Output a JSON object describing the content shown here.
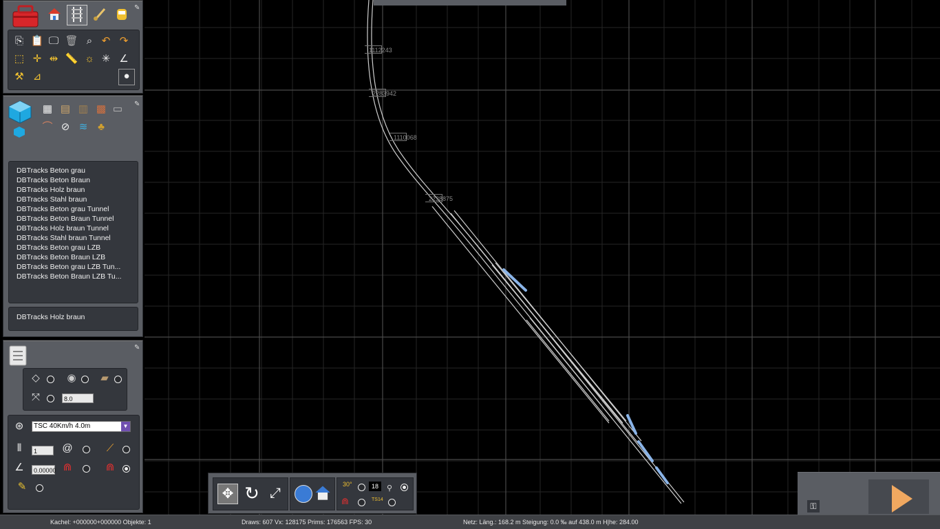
{
  "track_tags": [
    {
      "label": "1112243"
    },
    {
      "label": "2283942"
    },
    {
      "label": "1110068"
    },
    {
      "label": "2238875"
    }
  ],
  "track_list": {
    "items": [
      "DBTracks Beton grau",
      "DBTracks Beton Braun",
      "DBTracks Holz braun",
      "DBTracks Stahl braun",
      "DBTracks Beton grau Tunnel",
      "DBTracks Beton Braun Tunnel",
      "DBTracks Holz braun Tunnel",
      "DBTracks Stahl braun Tunnel",
      "DBTracks Beton grau LZB",
      "DBTracks Beton Braun LZB",
      "DBTracks Beton grau LZB Tun...",
      "DBTracks Beton Braun LZB Tu..."
    ],
    "selected": "DBTracks Holz braun"
  },
  "track_settings": {
    "spacing_value": "8.0",
    "track_rule": "TSC 40Km/h 4.0m",
    "count_value": "1",
    "gradient_value": "0.00000"
  },
  "bottom_toolbar": {
    "number_box": "18",
    "ts14_label": "TS14",
    "angle_label": "30°"
  },
  "status": {
    "tile": "Kachel: +000000+000000  Objekte: 1",
    "render": "Draws: 607 Vx: 128175 Prims: 176563 FPS: 30",
    "net": "Netz:  Läng.:  168.2 m Steigung:  0.0 ‰ auf 438.0 m H|he: 284.00"
  },
  "colors": {
    "panel_bg": "#5a5d63",
    "panel_inner": "#34373d",
    "grid_line": "#2f2f2f",
    "grid_major": "#4a4a4a",
    "track": "#cfcfcf",
    "selected_track": "#8ab4e8",
    "accent_orange": "#f0a030"
  },
  "icons": {
    "toolbox": "toolbox-icon",
    "home": "home-icon",
    "track": "track-icon",
    "paint": "brush-icon",
    "driver": "driver-icon",
    "play": "play-icon",
    "lock": "lock-icon"
  }
}
